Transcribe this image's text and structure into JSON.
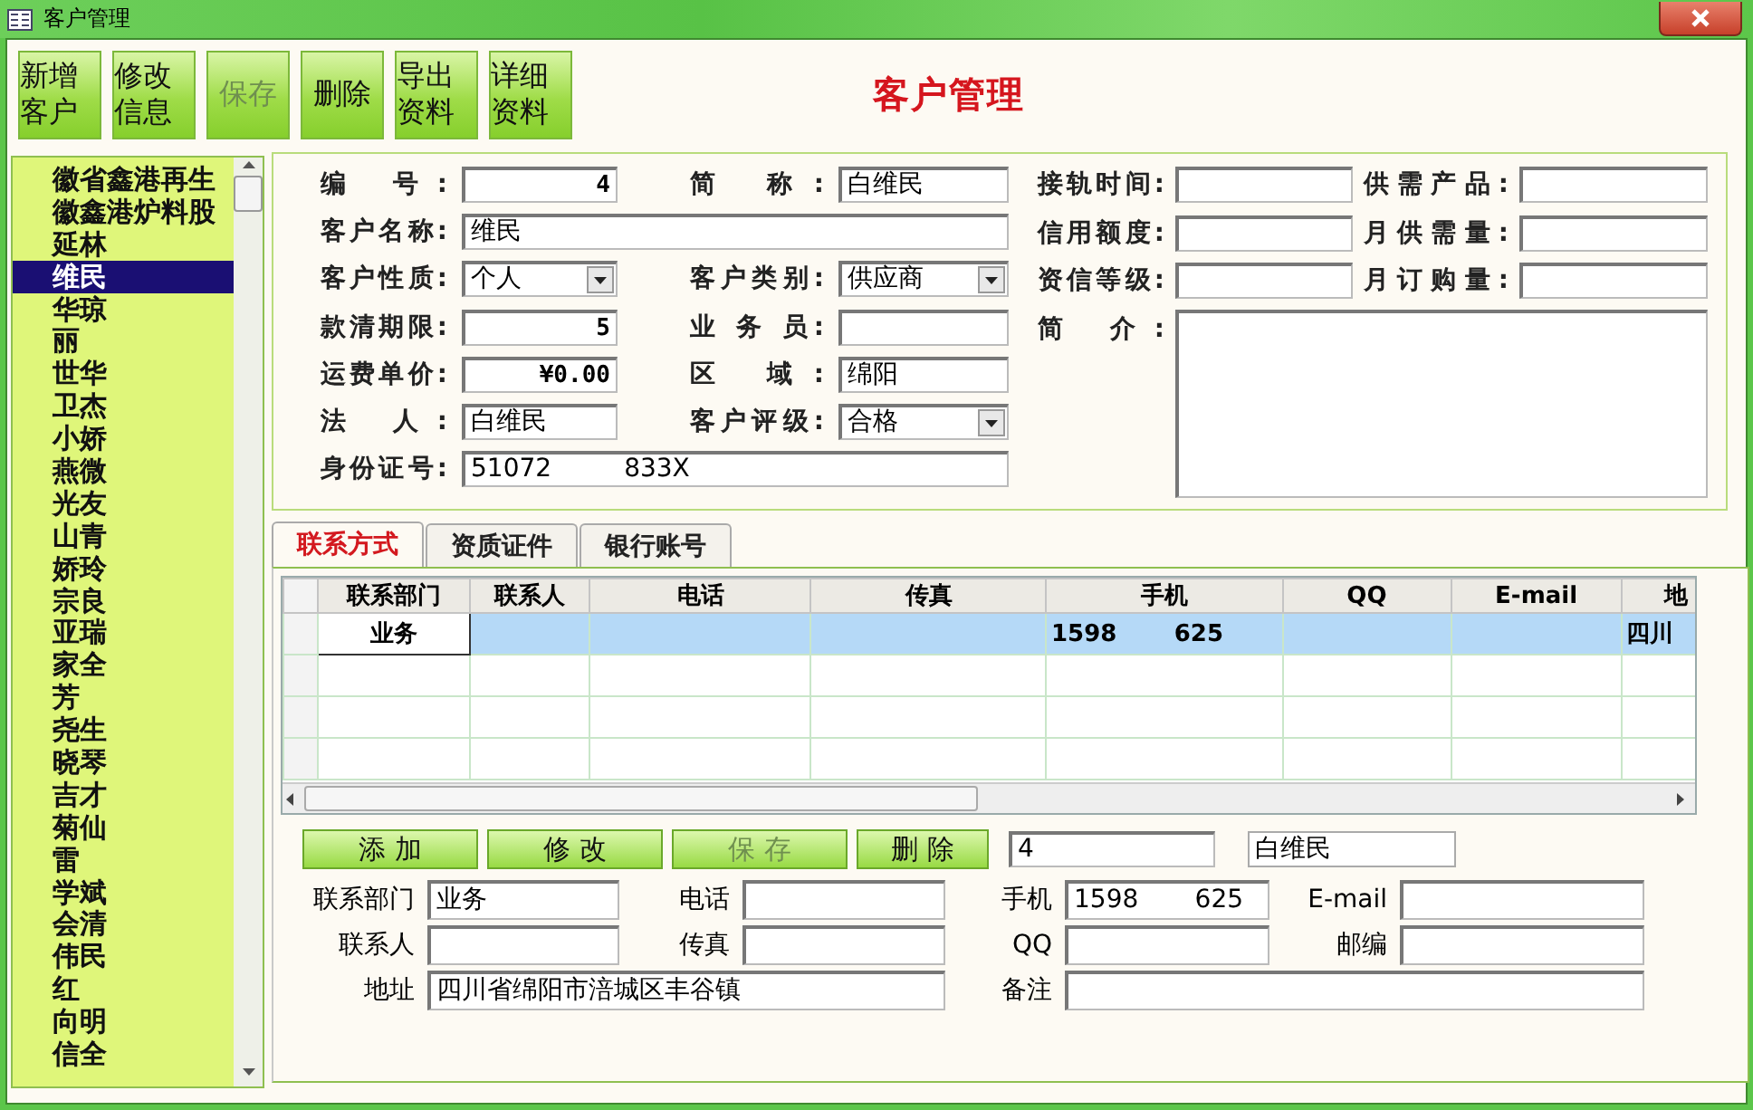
{
  "window": {
    "title": "客户管理"
  },
  "toolbar": [
    {
      "label": "新增客户",
      "disabled": false
    },
    {
      "label": "修改信息",
      "disabled": false
    },
    {
      "label": "保存",
      "disabled": true
    },
    {
      "label": "删除",
      "disabled": false
    },
    {
      "label": "导出资料",
      "disabled": false
    },
    {
      "label": "详细资料",
      "disabled": false
    }
  ],
  "heading": "客户管理",
  "customers": [
    {
      "name": "徽省鑫港再生",
      "selected": false
    },
    {
      "name": "徽鑫港炉料股",
      "selected": false
    },
    {
      "name": "延林",
      "selected": false
    },
    {
      "name": "维民",
      "selected": true
    },
    {
      "name": "华琼",
      "selected": false
    },
    {
      "name": "丽",
      "selected": false
    },
    {
      "name": "世华",
      "selected": false
    },
    {
      "name": "卫杰",
      "selected": false
    },
    {
      "name": "小娇",
      "selected": false
    },
    {
      "name": "燕微",
      "selected": false
    },
    {
      "name": "光友",
      "selected": false
    },
    {
      "name": "山青",
      "selected": false
    },
    {
      "name": "娇玲",
      "selected": false
    },
    {
      "name": "宗良",
      "selected": false
    },
    {
      "name": "亚瑞",
      "selected": false
    },
    {
      "name": "家全",
      "selected": false
    },
    {
      "name": "芳",
      "selected": false
    },
    {
      "name": "尧生",
      "selected": false
    },
    {
      "name": "晓琴",
      "selected": false
    },
    {
      "name": "吉才",
      "selected": false
    },
    {
      "name": "菊仙",
      "selected": false
    },
    {
      "name": "雷",
      "selected": false
    },
    {
      "name": "学斌",
      "selected": false
    },
    {
      "name": "会清",
      "selected": false
    },
    {
      "name": "伟民",
      "selected": false
    },
    {
      "name": "红",
      "selected": false
    },
    {
      "name": "向明",
      "selected": false
    },
    {
      "name": "信全",
      "selected": false
    }
  ],
  "form": {
    "left_rows": [
      [
        {
          "label": "编 号:",
          "value": "4",
          "kind": "number"
        },
        {
          "label": "简 称:",
          "value": "白维民",
          "kind": "text"
        }
      ],
      [
        {
          "label": "客户名称:",
          "value": "维民",
          "kind": "text"
        }
      ],
      [
        {
          "label": "客户性质:",
          "value": "个人",
          "kind": "combo"
        },
        {
          "label": "客户类别:",
          "value": "供应商",
          "kind": "combo"
        }
      ],
      [
        {
          "label": "款清期限:",
          "value": "5",
          "kind": "number"
        },
        {
          "label": "业 务 员:",
          "kind": "text"
        }
      ],
      [
        {
          "label": "运费单价:",
          "value": "¥0.00",
          "kind": "number"
        },
        {
          "label": "区 域:",
          "value": "绵阳",
          "kind": "text"
        }
      ],
      [
        {
          "label": "法 人:",
          "value": "白维民",
          "kind": "text"
        },
        {
          "label": "客户评级:",
          "value": "合格",
          "kind": "combo"
        }
      ],
      [
        {
          "label": "身份证号:",
          "value": "51072         833X",
          "kind": "text"
        }
      ]
    ],
    "right_rows": [
      [
        {
          "label": "接轨时间:",
          "kind": "text"
        },
        {
          "label": "供需产品:",
          "kind": "text"
        }
      ],
      [
        {
          "label": "信用额度:",
          "kind": "text"
        },
        {
          "label": "月供需量:",
          "kind": "text"
        }
      ],
      [
        {
          "label": "资信等级:",
          "kind": "text"
        },
        {
          "label": "月订购量:",
          "kind": "text"
        }
      ]
    ],
    "memo": {
      "label": "简 介:"
    }
  },
  "tabs": [
    {
      "label": "联系方式",
      "selected": true
    },
    {
      "label": "资质证件",
      "selected": false
    },
    {
      "label": "银行账号",
      "selected": false
    }
  ],
  "table": {
    "columns": [
      "联系部门",
      "联系人",
      "电话",
      "传真",
      "手机",
      "QQ",
      "E-mail",
      "地"
    ],
    "rows": [
      [
        "业务",
        null,
        null,
        null,
        "1598       625",
        null,
        null,
        "四川"
      ]
    ]
  },
  "contact_buttons": [
    {
      "label": "添 加",
      "disabled": false
    },
    {
      "label": "修 改",
      "disabled": false
    },
    {
      "label": "保 存",
      "disabled": true
    },
    {
      "label": "删 除",
      "disabled": false
    }
  ],
  "id_field": "4",
  "name_field": "白维民",
  "contact_fields": [
    {
      "label": "联系部门",
      "value": "业务"
    },
    {
      "label": "电话"
    },
    {
      "label": "手机",
      "value": "1598       625"
    },
    {
      "label": "E-mail"
    },
    {
      "label": "联系人"
    },
    {
      "label": "传真"
    },
    {
      "label": "QQ"
    },
    {
      "label": "邮编"
    },
    {
      "label": "地址",
      "value": "四川省绵阳市涪城区丰谷镇"
    },
    {
      "label": "备注"
    }
  ]
}
